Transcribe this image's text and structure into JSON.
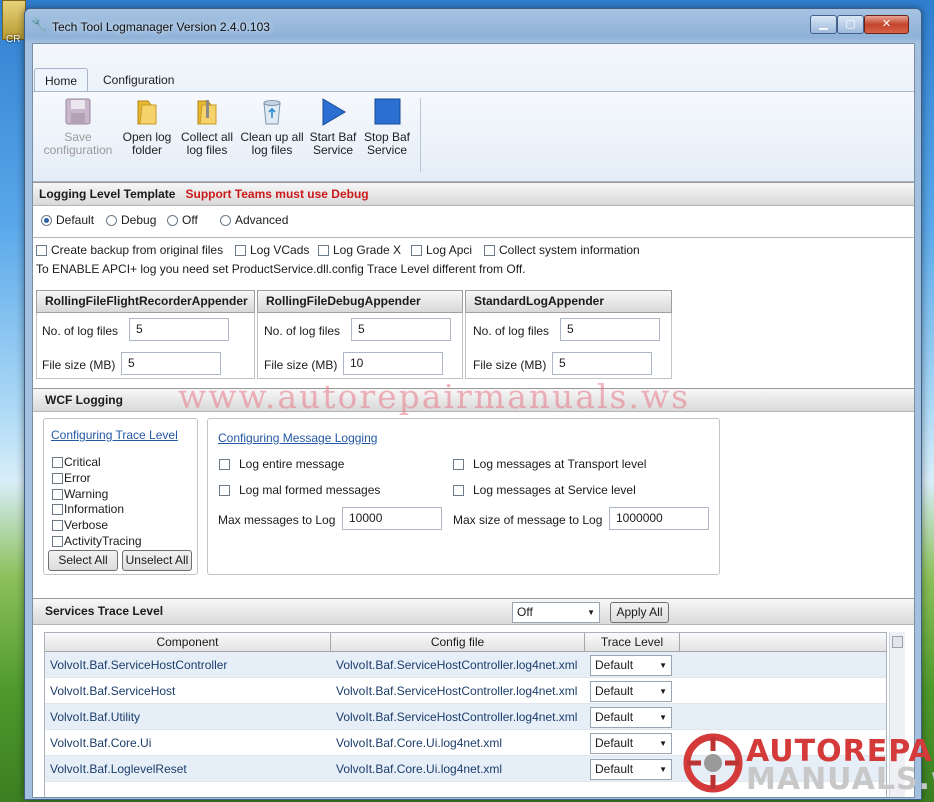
{
  "desktop": {
    "icon_label": "CR"
  },
  "window": {
    "title": "Tech Tool Logmanager Version 2.4.0.103",
    "minimize": "▁",
    "maximize": "▢",
    "close": "✕"
  },
  "ribbon": {
    "tabs": [
      {
        "label": "Home"
      },
      {
        "label": "Configuration"
      }
    ],
    "buttons": [
      {
        "label1": "Save",
        "label2": "configuration",
        "icon": "save-icon"
      },
      {
        "label1": "Open log",
        "label2": "folder",
        "icon": "folder-icon"
      },
      {
        "label1": "Collect all",
        "label2": "log files",
        "icon": "zip-folder-icon"
      },
      {
        "label1": "Clean up all",
        "label2": "log files",
        "icon": "recycle-bin-icon"
      },
      {
        "label1": "Start Baf",
        "label2": "Service",
        "icon": "play-icon"
      },
      {
        "label1": "Stop Baf",
        "label2": "Service",
        "icon": "stop-icon"
      }
    ]
  },
  "logging_level": {
    "title": "Logging Level Template",
    "warning": "Support Teams must use Debug",
    "options": [
      "Default",
      "Debug",
      "Off",
      "Advanced"
    ],
    "selected": "Default"
  },
  "options": {
    "checkboxes": [
      "Create backup from original files",
      "Log VCads",
      "Log Grade X",
      "Log Apci",
      "Collect system information"
    ],
    "note": "To ENABLE APCI+ log you need set ProductService.dll.config Trace Level different from Off."
  },
  "appenders": [
    {
      "name": "RollingFileFlightRecorderAppender",
      "files_label": "No. of log files",
      "files": "5",
      "size_label": "File size (MB)",
      "size": "5"
    },
    {
      "name": "RollingFileDebugAppender",
      "files_label": "No. of log files",
      "files": "5",
      "size_label": "File size (MB)",
      "size": "10"
    },
    {
      "name": "StandardLogAppender",
      "files_label": "No. of log files",
      "files": "5",
      "size_label": "File size (MB)",
      "size": "5"
    }
  ],
  "wcf": {
    "title": "WCF Logging",
    "trace_link": "Configuring Trace Level",
    "trace_levels": [
      "Critical",
      "Error",
      "Warning",
      "Information",
      "Verbose",
      "ActivityTracing"
    ],
    "select_all": "Select All",
    "unselect_all": "Unselect All",
    "msg_link": "Configuring Message Logging",
    "msg_opts": [
      "Log entire message",
      "Log mal formed messages",
      "Log messages at Transport level",
      "Log messages at Service level"
    ],
    "max_msgs_label": "Max messages to Log",
    "max_msgs": "10000",
    "max_size_label": "Max size of message to Log",
    "max_size": "1000000"
  },
  "services": {
    "title": "Services Trace Level",
    "level": "Off",
    "apply": "Apply All",
    "columns": [
      "Component",
      "Config file",
      "Trace Level"
    ],
    "rows": [
      {
        "component": "VolvoIt.Baf.ServiceHostController",
        "config": "VolvoIt.Baf.ServiceHostController.log4net.xml",
        "level": "Default"
      },
      {
        "component": "VolvoIt.Baf.ServiceHost",
        "config": "VolvoIt.Baf.ServiceHostController.log4net.xml",
        "level": "Default"
      },
      {
        "component": "VolvoIt.Baf.Utility",
        "config": "VolvoIt.Baf.ServiceHostController.log4net.xml",
        "level": "Default"
      },
      {
        "component": "VolvoIt.Baf.Core.Ui",
        "config": "VolvoIt.Baf.Core.Ui.log4net.xml",
        "level": "Default"
      },
      {
        "component": "VolvoIt.Baf.LoglevelReset",
        "config": "VolvoIt.Baf.Core.Ui.log4net.xml",
        "level": "Default"
      }
    ]
  },
  "watermark": {
    "text": "www.autorepairmanuals.ws",
    "logo_line1": "AUTOREPAIR",
    "logo_line2": "MANUALS.ws"
  }
}
